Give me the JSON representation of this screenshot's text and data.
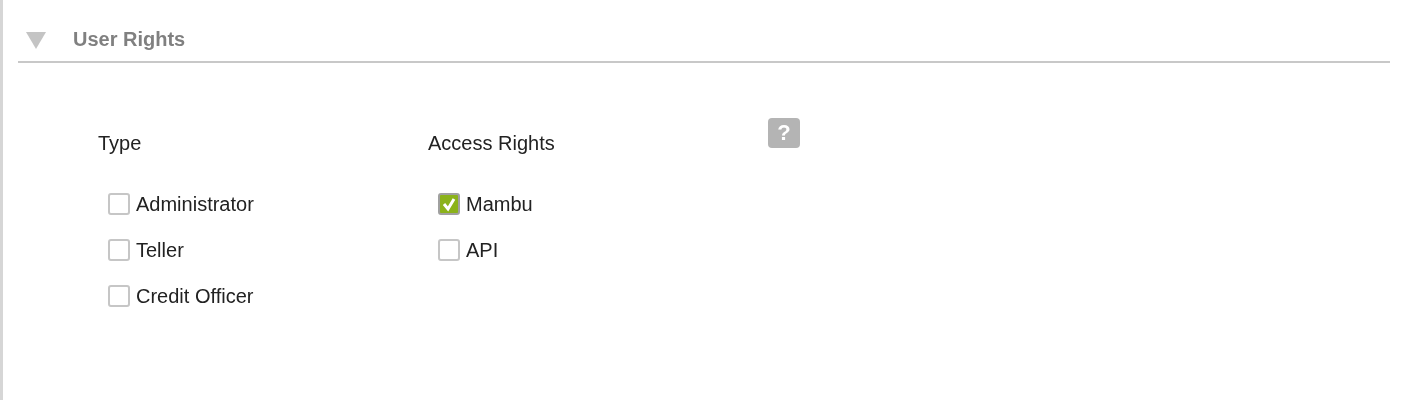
{
  "section": {
    "title": "User Rights",
    "expanded": true
  },
  "type_group": {
    "label": "Type",
    "options": [
      {
        "label": "Administrator",
        "checked": false
      },
      {
        "label": "Teller",
        "checked": false
      },
      {
        "label": "Credit Officer",
        "checked": false
      }
    ]
  },
  "access_group": {
    "label": "Access Rights",
    "options": [
      {
        "label": "Mambu",
        "checked": true
      },
      {
        "label": "API",
        "checked": false
      }
    ]
  },
  "help": {
    "symbol": "?"
  }
}
